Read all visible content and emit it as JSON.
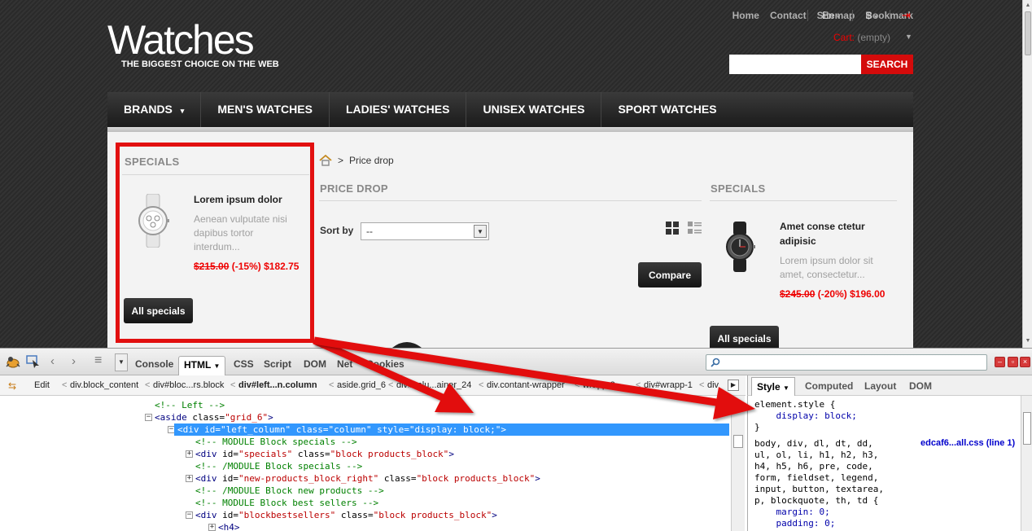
{
  "site": {
    "logo": "Watches",
    "tagline": "THE BIGGEST CHOICE ON THE WEB",
    "top_links": [
      "Home",
      "Contact",
      "Sitemap",
      "Bookmark"
    ],
    "language": "En",
    "currency": "$",
    "cart_label": "Cart:",
    "cart_value": "(empty)",
    "search_button": "SEARCH",
    "search_value": "",
    "nav": [
      "BRANDS",
      "MEN'S WATCHES",
      "LADIES' WATCHES",
      "UNISEX WATCHES",
      "SPORT WATCHES"
    ],
    "left_specials": {
      "title": "SPECIALS",
      "product_name": "Lorem ipsum dolor",
      "desc": [
        "Aenean vulputate nisi",
        "dapibus tortor",
        "interdum..."
      ],
      "old_price": "$215.00",
      "discount": "(-15%)",
      "price": "$182.75",
      "button": "All specials"
    },
    "breadcrumb": "Price drop",
    "main_title": "PRICE DROP",
    "sort_label": "Sort by",
    "sort_value": "--",
    "compare_button": "Compare",
    "right_specials": {
      "title": "SPECIALS",
      "product_name": [
        "Amet conse ctetur",
        "adipisic"
      ],
      "desc": [
        "Lorem ipsum dolor sit",
        "amet, consectetur..."
      ],
      "old_price": "$245.00",
      "discount": "(-20%)",
      "price": "$196.00",
      "button": "All specials"
    }
  },
  "firebug": {
    "tabs": [
      "Console",
      "HTML",
      "CSS",
      "Script",
      "DOM",
      "Net",
      "Cookies"
    ],
    "active_tab": "HTML",
    "search_placeholder": "",
    "edit_label": "Edit",
    "crumbs": [
      "div.block_content",
      "div#bloc...rs.block",
      "div#left...n.column",
      "aside.grid_6",
      "div#colu...ainer_24",
      "div.contant-wrapper",
      "wrapp-2",
      "div#wrapp-1",
      "div"
    ],
    "side_tabs": [
      "Style",
      "Computed",
      "Layout",
      "DOM"
    ],
    "html_lines": [
      {
        "indent": 190,
        "type": "comment",
        "text": "<!-- Left -->"
      },
      {
        "indent": 190,
        "type": "tag",
        "toggle": "−",
        "parts": [
          [
            "tg",
            "<aside "
          ],
          [
            "an",
            "class="
          ],
          [
            "av",
            "\"grid_6\""
          ],
          [
            "tg",
            ">"
          ]
        ]
      },
      {
        "indent": 218,
        "type": "tag",
        "toggle": "−",
        "selected": true,
        "parts": [
          [
            "tg",
            "<div "
          ],
          [
            "an",
            "id="
          ],
          [
            "av",
            "\"left_column\" "
          ],
          [
            "an",
            "class="
          ],
          [
            "av",
            "\"column\" "
          ],
          [
            "an",
            "style="
          ],
          [
            "av",
            "\"display: block;\""
          ],
          [
            "tg",
            ">"
          ]
        ]
      },
      {
        "indent": 240,
        "type": "comment",
        "text": "<!-- MODULE Block specials -->"
      },
      {
        "indent": 240,
        "type": "tag",
        "toggle": "+",
        "parts": [
          [
            "tg",
            "<div "
          ],
          [
            "an",
            "id="
          ],
          [
            "av",
            "\"specials\" "
          ],
          [
            "an",
            "class="
          ],
          [
            "av",
            "\"block products_block\""
          ],
          [
            "tg",
            ">"
          ]
        ]
      },
      {
        "indent": 240,
        "type": "comment",
        "text": "<!-- /MODULE Block specials -->"
      },
      {
        "indent": 240,
        "type": "tag",
        "toggle": "+",
        "parts": [
          [
            "tg",
            "<div "
          ],
          [
            "an",
            "id="
          ],
          [
            "av",
            "\"new-products_block_right\" "
          ],
          [
            "an",
            "class="
          ],
          [
            "av",
            "\"block products_block\""
          ],
          [
            "tg",
            ">"
          ]
        ]
      },
      {
        "indent": 240,
        "type": "comment",
        "text": "<!-- /MODULE Block new products -->"
      },
      {
        "indent": 240,
        "type": "comment",
        "text": "<!-- MODULE Block best sellers -->"
      },
      {
        "indent": 240,
        "type": "tag",
        "toggle": "−",
        "parts": [
          [
            "tg",
            "<div "
          ],
          [
            "an",
            "id="
          ],
          [
            "av",
            "\"blockbestsellers\" "
          ],
          [
            "an",
            "class="
          ],
          [
            "av",
            "\"block products_block\""
          ],
          [
            "tg",
            ">"
          ]
        ]
      },
      {
        "indent": 268,
        "type": "tag",
        "toggle": "+",
        "parts": [
          [
            "tg",
            "<h4>"
          ]
        ]
      }
    ],
    "style_lines": [
      {
        "cls": "",
        "text": "element.style {"
      },
      {
        "cls": "st-prop",
        "text": "    display: block;"
      },
      {
        "cls": "",
        "text": "}"
      },
      {
        "cls": "",
        "text": ""
      },
      {
        "cls": "",
        "text": "body, div, dl, dt, dd,"
      },
      {
        "cls": "",
        "text": "ul, ol, li, h1, h2, h3,"
      },
      {
        "cls": "",
        "text": "h4, h5, h6, pre, code,"
      },
      {
        "cls": "",
        "text": "form, fieldset, legend,"
      },
      {
        "cls": "",
        "text": "input, button, textarea,"
      },
      {
        "cls": "",
        "text": "p, blockquote, th, td {"
      },
      {
        "cls": "st-prop",
        "text": "    margin: 0;"
      },
      {
        "cls": "st-prop",
        "text": "    padding: 0;"
      }
    ],
    "style_source": "edcaf6...all.css (line 1)"
  },
  "colors": {
    "accent_red": "#e21010",
    "selection_blue": "#3297fd"
  }
}
